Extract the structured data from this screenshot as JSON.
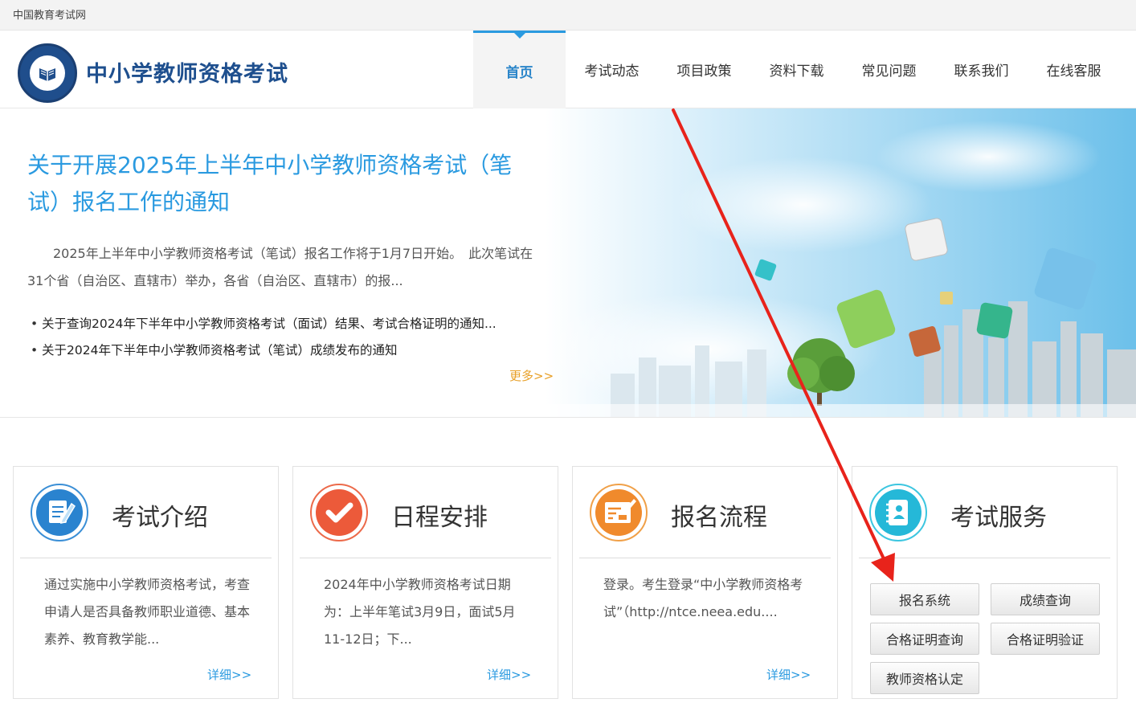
{
  "topbar": {
    "site_link": "中国教育考试网"
  },
  "header": {
    "site_title": "中小学教师资格考试",
    "nav": [
      {
        "label": "首页",
        "active": true
      },
      {
        "label": "考试动态"
      },
      {
        "label": "项目政策"
      },
      {
        "label": "资料下载"
      },
      {
        "label": "常见问题"
      },
      {
        "label": "联系我们"
      },
      {
        "label": "在线客服"
      }
    ]
  },
  "banner": {
    "title": "关于开展2025年上半年中小学教师资格考试（笔试）报名工作的通知",
    "summary": "2025年上半年中小学教师资格考试（笔试）报名工作将于1月7日开始。　此次笔试在31个省（自治区、直辖市）举办，各省（自治区、直辖市）的报...",
    "news": [
      "关于查询2024年下半年中小学教师资格考试（面试）结果、考试合格证明的通知...",
      "关于2024年下半年中小学教师资格考试（笔试）成绩发布的通知"
    ],
    "more": "更多>>"
  },
  "cards": [
    {
      "title": "考试介绍",
      "icon": "document-edit-icon",
      "text": "通过实施中小学教师资格考试，考查申请人是否具备教师职业道德、基本素养、教育教学能...",
      "more": "详细>>"
    },
    {
      "title": "日程安排",
      "icon": "checkmark-icon",
      "text": "2024年中小学教师资格考试日期为：上半年笔试3月9日，面试5月11-12日；下...",
      "more": "详细>>"
    },
    {
      "title": "报名流程",
      "icon": "registration-form-icon",
      "text": "登录。考生登录“中小学教师资格考试”（http://ntce.neea.edu....",
      "more": "详细>>"
    },
    {
      "title": "考试服务",
      "icon": "contact-book-icon",
      "buttons": [
        "报名系统",
        "成绩查询",
        "合格证明查询",
        "合格证明验证",
        "教师资格认定"
      ]
    }
  ],
  "colors": {
    "brand_blue": "#2a9ae0",
    "title_navy": "#1e4f8e",
    "more_orange": "#e8a028",
    "annotation_red": "#e8231b"
  }
}
